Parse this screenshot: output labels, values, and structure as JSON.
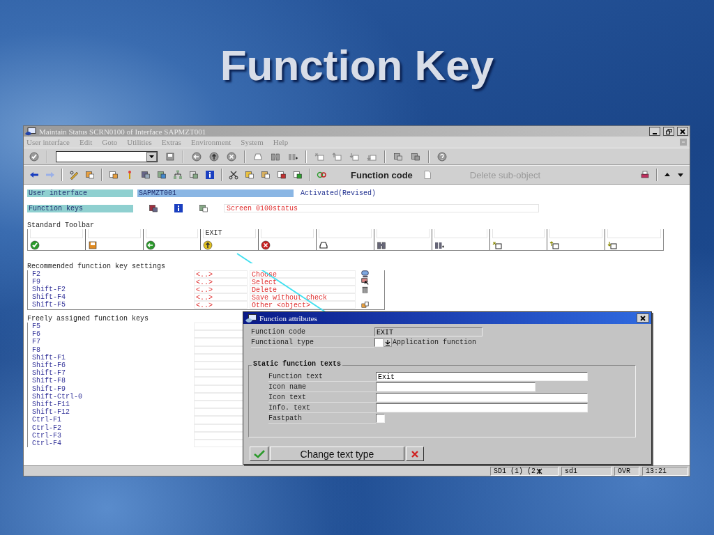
{
  "slide_title": "Function Key",
  "window": {
    "title": "Maintain Status SCRN0100 of Interface SAPMZT001"
  },
  "menu": [
    {
      "label": "User interface"
    },
    {
      "label": "Edit"
    },
    {
      "label": "Goto"
    },
    {
      "label": "Utilities"
    },
    {
      "label": "Extras"
    },
    {
      "label": "Environment"
    },
    {
      "label": "System"
    },
    {
      "label": "Help"
    }
  ],
  "application_toolbar": [
    {
      "label": "Function code",
      "disabled": false
    },
    {
      "label": "Delete sub-object",
      "disabled": true
    }
  ],
  "header": {
    "user_interface_label": "User interface",
    "program": "SAPMZT001",
    "status": "Activated(Revised)",
    "function_keys_label": "Function keys",
    "screen_text": "Screen 0100status"
  },
  "standard_toolbar": {
    "title": "Standard Toolbar",
    "slots": [
      {
        "kind": "enter"
      },
      {
        "kind": "save"
      },
      {
        "kind": "back"
      },
      {
        "kind": "exit",
        "code": "EXIT"
      },
      {
        "kind": "cancel"
      },
      {
        "kind": "print"
      },
      {
        "kind": "find"
      },
      {
        "kind": "find_next"
      },
      {
        "kind": "first_page"
      },
      {
        "kind": "previous_page"
      },
      {
        "kind": "next_page"
      }
    ]
  },
  "recommended": {
    "title": "Recommended function key settings",
    "rows": [
      {
        "key": "F2",
        "code": "<..>",
        "text": "Choose",
        "kind": "choose"
      },
      {
        "key": "F9",
        "code": "<..>",
        "text": "Select",
        "kind": "select"
      },
      {
        "key": "Shift-F2",
        "code": "<..>",
        "text": "Delete",
        "kind": "delete"
      },
      {
        "key": "Shift-F4",
        "code": "<..>",
        "text": "Save without check",
        "kind": "none"
      },
      {
        "key": "Shift-F5",
        "code": "<..>",
        "text": "Other <object>",
        "kind": "other"
      }
    ]
  },
  "freely_assigned": {
    "title": "Freely assigned function keys",
    "keys": [
      "F5",
      "F6",
      "F7",
      "F8",
      "Shift-F1",
      "Shift-F6",
      "Shift-F7",
      "Shift-F8",
      "Shift-F9",
      "Shift-Ctrl-0",
      "Shift-F11",
      "Shift-F12",
      "Ctrl-F1",
      "Ctrl-F2",
      "Ctrl-F3",
      "Ctrl-F4"
    ]
  },
  "dialog": {
    "title": "Function attributes",
    "function_code_label": "Function code",
    "function_code": "EXIT",
    "functional_type_label": "Functional type",
    "functional_type_text": "Application function",
    "group": {
      "title": "Static function texts",
      "fields": [
        {
          "label": "Function text",
          "value": "Exit",
          "kind": "long"
        },
        {
          "label": "Icon name",
          "kind": "medium"
        },
        {
          "label": "Icon text",
          "kind": "long"
        },
        {
          "label": "Info. text",
          "kind": "long"
        },
        {
          "label": "Fastpath",
          "kind": "short"
        }
      ]
    },
    "button": "Change text type"
  },
  "status_bar": {
    "system": "SD1 (1) (2",
    "user": "sd1",
    "mode": "OVR",
    "time": "13:21"
  }
}
